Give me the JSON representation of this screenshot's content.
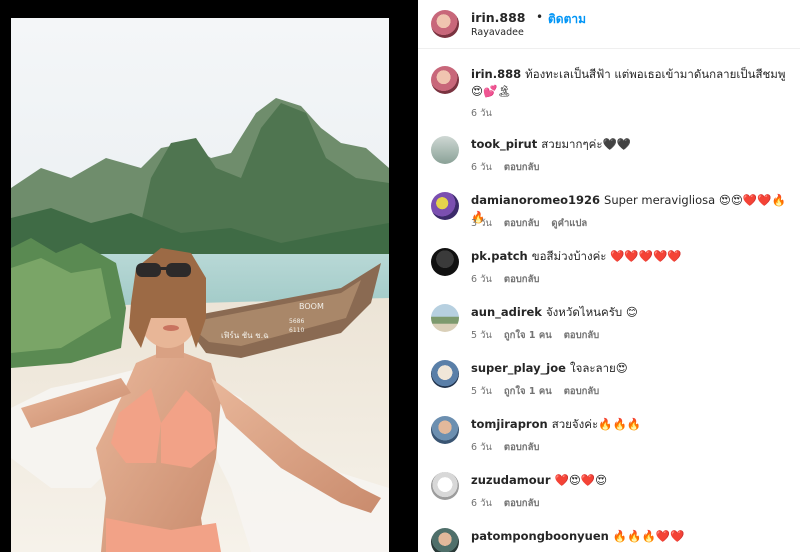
{
  "header": {
    "username": "irin.888",
    "dot": "•",
    "follow_label": "ติดตาม",
    "location": "Rayavadee"
  },
  "caption": {
    "username": "irin.888",
    "text": "ท้องทะเลเป็นสีฟ้า แต่พอเธอเข้ามาดันกลายเป็นสีชมพู 😍💕🏝",
    "time": "6 วัน"
  },
  "comments": [
    {
      "username": "took_pirut",
      "text": "สวยมากๆค่ะ🖤🖤",
      "time": "6 วัน",
      "likes": "",
      "reply": "ตอบกลับ",
      "translate": ""
    },
    {
      "username": "damianoromeo1926",
      "text": "Super meravigliosa 😍😍❤️❤️🔥🔥",
      "time": "3 วัน",
      "likes": "",
      "reply": "ตอบกลับ",
      "translate": "ดูคำแปล"
    },
    {
      "username": "pk.patch",
      "text": "ขอสีม่วงบ้างค่ะ ❤️❤️❤️❤️❤️",
      "time": "6 วัน",
      "likes": "",
      "reply": "ตอบกลับ",
      "translate": ""
    },
    {
      "username": "aun_adirek",
      "text": "จังหวัดไหนครับ 😊",
      "time": "5 วัน",
      "likes": "ถูกใจ 1 คน",
      "reply": "ตอบกลับ",
      "translate": ""
    },
    {
      "username": "super_play_joe",
      "text": "ใจละลาย😍",
      "time": "5 วัน",
      "likes": "ถูกใจ 1 คน",
      "reply": "ตอบกลับ",
      "translate": ""
    },
    {
      "username": "tomjirapron",
      "text": "สวยจังค่ะ🔥🔥🔥",
      "time": "6 วัน",
      "likes": "",
      "reply": "ตอบกลับ",
      "translate": ""
    },
    {
      "username": "zuzudamour",
      "text": "❤️😍❤️😍",
      "time": "6 วัน",
      "likes": "",
      "reply": "ตอบกลับ",
      "translate": ""
    },
    {
      "username": "patompongboonyuen",
      "text": "🔥🔥🔥❤️❤️",
      "time": "",
      "likes": "",
      "reply": "",
      "translate": ""
    }
  ],
  "media": {
    "boat_text_1": "BOOM",
    "boat_text_2": "เฟิร์น ชัน ช.ฉ",
    "boat_text_3": "5686",
    "boat_text_4": "6110"
  }
}
